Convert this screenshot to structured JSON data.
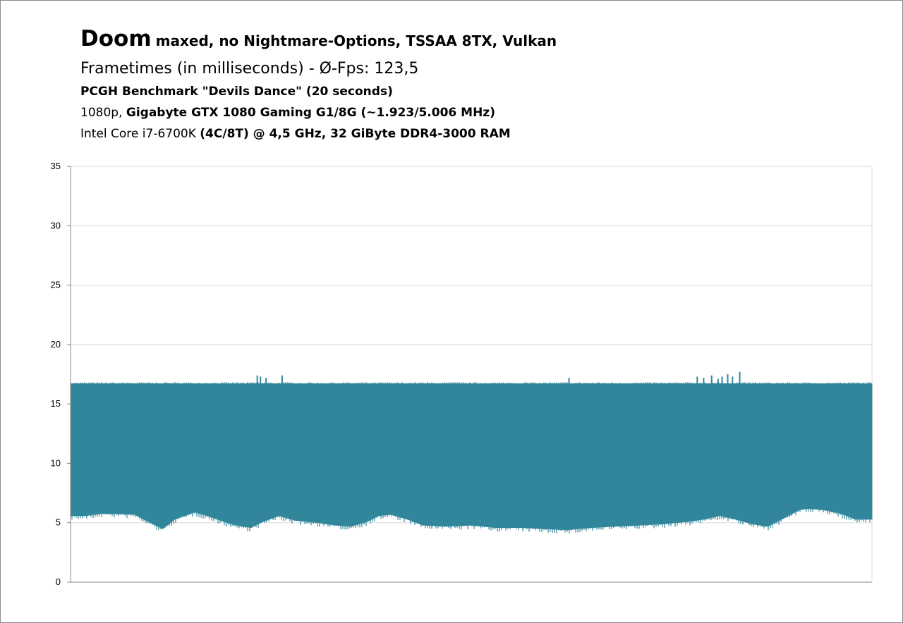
{
  "title": {
    "main": "Doom",
    "sub": "maxed, no Nightmare-Options,  TSSAA 8TX, Vulkan",
    "line2": "Frametimes (in milliseconds) - Ø-Fps: 123,5",
    "line3": "PCGH Benchmark \"Devils Dance\" (20 seconds)",
    "line4_normal": "1080p, ",
    "line4_bold": "Gigabyte GTX 1080 Gaming G1/8G (~1.923/5.006 MHz)",
    "line5_normal": "Intel Core i7-6700K ",
    "line5_bold": "(4C/8T) @ 4,5 GHz, 32 GiByte DDR4-3000 RAM"
  },
  "colors": {
    "series": "#31869b",
    "grid": "#d9d9d9",
    "axis": "#868686"
  },
  "chart_data": {
    "type": "area",
    "title": "Doom maxed, no Nightmare-Options, TSSAA 8TX, Vulkan",
    "xlabel": "",
    "ylabel": "",
    "ylim": [
      0,
      35
    ],
    "yticks": [
      "0",
      "5",
      "10",
      "15",
      "20",
      "25",
      "30",
      "35"
    ],
    "grid": true,
    "legend": "none",
    "series": [
      {
        "kind": "band_upper",
        "x": [
          0,
          0.1,
          0.2,
          0.3,
          0.4,
          0.5,
          0.6,
          0.7,
          0.8,
          0.9,
          1.0
        ],
        "y": [
          16.7,
          16.7,
          16.7,
          16.7,
          16.7,
          16.7,
          16.7,
          16.7,
          16.7,
          16.7,
          16.7
        ]
      },
      {
        "kind": "band_lower",
        "x": [
          0,
          0.02,
          0.04,
          0.08,
          0.1,
          0.115,
          0.13,
          0.155,
          0.17,
          0.2,
          0.215,
          0.225,
          0.24,
          0.26,
          0.28,
          0.31,
          0.33,
          0.35,
          0.37,
          0.385,
          0.4,
          0.42,
          0.44,
          0.47,
          0.5,
          0.53,
          0.56,
          0.59,
          0.62,
          0.65,
          0.68,
          0.71,
          0.74,
          0.77,
          0.79,
          0.81,
          0.83,
          0.85,
          0.87,
          0.89,
          0.91,
          0.92,
          0.94,
          0.96,
          0.98,
          1.0
        ],
        "y": [
          5.6,
          5.6,
          5.8,
          5.7,
          5.0,
          4.5,
          5.3,
          5.9,
          5.6,
          4.9,
          4.7,
          4.6,
          5.1,
          5.6,
          5.2,
          5.0,
          4.8,
          4.7,
          5.1,
          5.6,
          5.7,
          5.3,
          4.8,
          4.7,
          4.8,
          4.6,
          4.6,
          4.5,
          4.4,
          4.6,
          4.7,
          4.8,
          4.9,
          5.1,
          5.3,
          5.6,
          5.3,
          4.9,
          4.7,
          5.4,
          6.1,
          6.2,
          6.1,
          5.8,
          5.3,
          5.3
        ]
      },
      {
        "kind": "spikes",
        "x": [
          0.233,
          0.237,
          0.244,
          0.264,
          0.622,
          0.782,
          0.79,
          0.8,
          0.808,
          0.813,
          0.82,
          0.826,
          0.835
        ],
        "y": [
          17.4,
          17.3,
          17.2,
          17.4,
          17.2,
          17.3,
          17.2,
          17.4,
          17.1,
          17.3,
          17.5,
          17.3,
          17.7
        ]
      }
    ]
  }
}
